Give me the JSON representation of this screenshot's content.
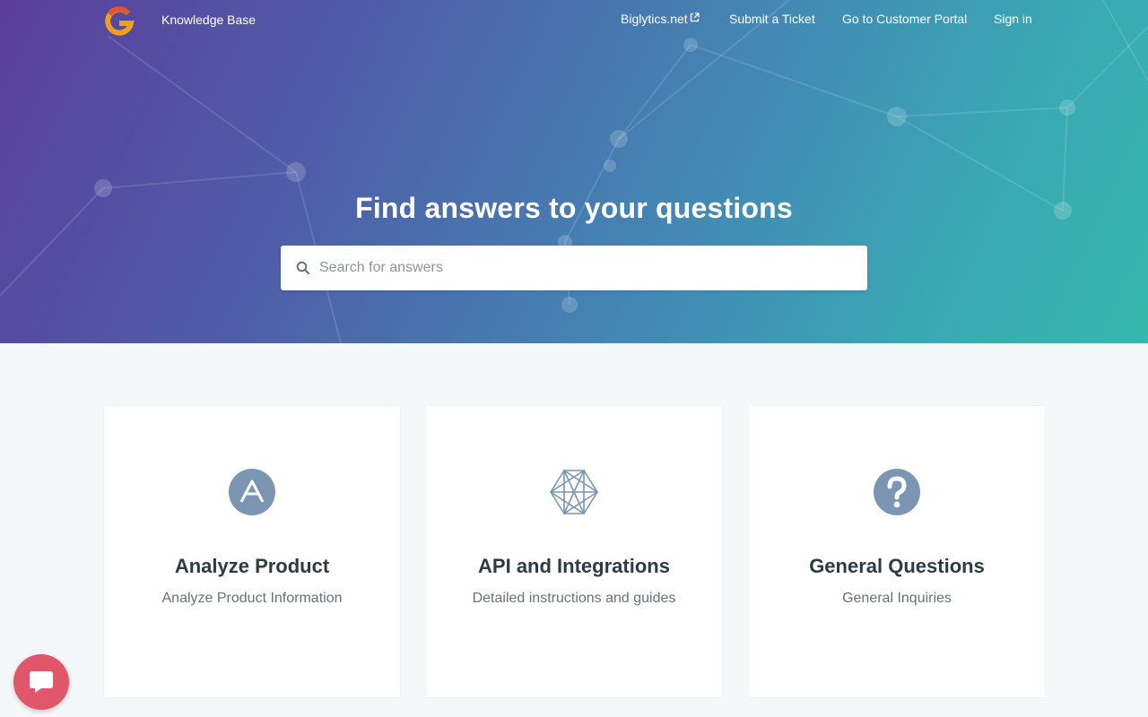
{
  "header": {
    "brand_label": "Knowledge Base",
    "nav": [
      {
        "label": "Biglytics.net",
        "icon": "external-link-icon"
      },
      {
        "label": "Submit a Ticket"
      },
      {
        "label": "Go to Customer Portal"
      },
      {
        "label": "Sign in"
      }
    ]
  },
  "hero": {
    "title": "Find answers to your questions",
    "search_placeholder": "Search for answers",
    "search_value": ""
  },
  "categories": [
    {
      "title": "Analyze Product",
      "description": "Analyze Product Information",
      "icon": "analyze-a-icon"
    },
    {
      "title": "API and Integrations",
      "description": "Detailed instructions and guides",
      "icon": "hexagon-network-icon"
    },
    {
      "title": "General Questions",
      "description": "General Inquiries",
      "icon": "question-circle-icon"
    }
  ],
  "chat": {
    "icon": "chat-bubble-icon"
  },
  "colors": {
    "hero_gradient_start": "#5a3f9c",
    "hero_gradient_end": "#36b8ad",
    "icon_color": "#7b96b2",
    "chat_button": "#e2566b",
    "page_background": "#f5f8f9"
  }
}
